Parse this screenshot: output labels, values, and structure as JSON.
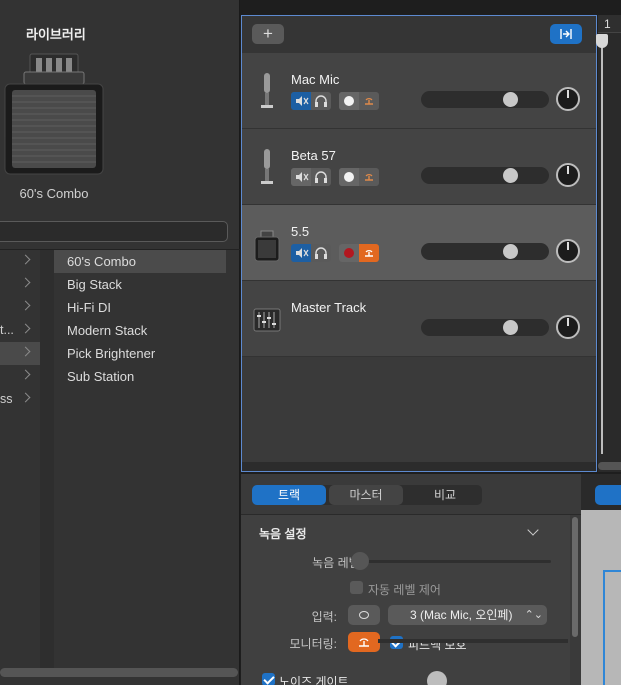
{
  "library": {
    "title": "라이브러리",
    "preset_name": "60's Combo",
    "search_placeholder": "",
    "categories": [
      {
        "label": ""
      },
      {
        "label": ""
      },
      {
        "label": ""
      },
      {
        "label": "t..."
      },
      {
        "label": ""
      },
      {
        "label": ""
      },
      {
        "label": "ss"
      }
    ],
    "presets": [
      {
        "label": "60's Combo"
      },
      {
        "label": "Big Stack"
      },
      {
        "label": "Hi-Fi DI"
      },
      {
        "label": "Modern Stack"
      },
      {
        "label": "Pick Brightener"
      },
      {
        "label": "Sub Station"
      }
    ]
  },
  "tracks": {
    "add_label": "+",
    "items": [
      {
        "name": "Mac Mic",
        "icon": "microphone-icon",
        "muted": true,
        "selected": false
      },
      {
        "name": "Beta 57",
        "icon": "microphone-icon",
        "muted": true,
        "selected": false
      },
      {
        "name": "5.5",
        "icon": "amp-icon",
        "muted": true,
        "selected": true
      },
      {
        "name": "Master Track",
        "icon": "master-track-icon",
        "muted": false,
        "selected": false
      }
    ]
  },
  "timeline": {
    "bar_number": "1"
  },
  "inspector": {
    "tabs": [
      {
        "label": "트랙"
      },
      {
        "label": "마스터"
      },
      {
        "label": "비교"
      }
    ],
    "section_title": "녹음 설정",
    "record_level_label": "녹음 레벨:",
    "auto_level_label": "자동 레벨 제어",
    "input_label": "입력:",
    "input_value": "3  (Mac Mic, 오인페)",
    "monitoring_label": "모니터링:",
    "feedback_label": "피드백 보호",
    "noise_gate_label": "노이즈 게이트"
  },
  "colors": {
    "accent_blue": "#1f72c6",
    "monitor_orange": "#e26820",
    "record_red": "#b2171f",
    "selection_border": "#5d8ad0"
  }
}
